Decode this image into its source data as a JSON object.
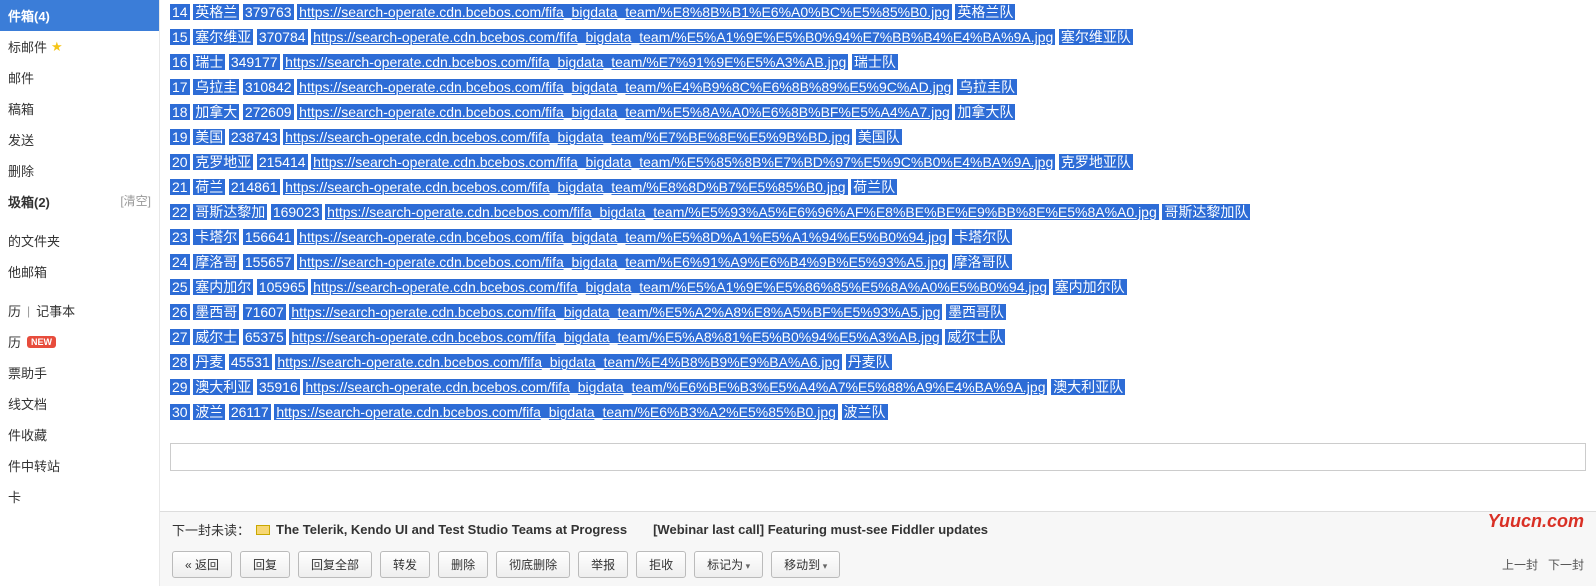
{
  "sidebar": {
    "inbox": "件箱(4)",
    "star": "标邮件",
    "mail": "邮件",
    "draft": "稿箱",
    "send": "发送",
    "delete": "删除",
    "trash": "圾箱(2)",
    "trash_clear": "[清空]",
    "folder": "的文件夹",
    "other_mail": "他邮箱",
    "cal": "历",
    "sep": "|",
    "notes": "记事本",
    "cal2": "历",
    "new_badge": "NEW",
    "bill": "票助手",
    "doc": "线文档",
    "fav": "件收藏",
    "transfer": "件中转站",
    "card": "卡"
  },
  "rows": [
    {
      "n": "14",
      "name": "英格兰",
      "num": "379763",
      "url": "https://search-operate.cdn.bcebos.com/fifa_bigdata_team/%E8%8B%B1%E6%A0%BC%E5%85%B0.jpg",
      "team": "英格兰队"
    },
    {
      "n": "15",
      "name": "塞尔维亚",
      "num": "370784",
      "url": "https://search-operate.cdn.bcebos.com/fifa_bigdata_team/%E5%A1%9E%E5%B0%94%E7%BB%B4%E4%BA%9A.jpg",
      "team": "塞尔维亚队"
    },
    {
      "n": "16",
      "name": "瑞士",
      "num": "349177",
      "url": "https://search-operate.cdn.bcebos.com/fifa_bigdata_team/%E7%91%9E%E5%A3%AB.jpg",
      "team": "瑞士队"
    },
    {
      "n": "17",
      "name": "乌拉圭",
      "num": "310842",
      "url": "https://search-operate.cdn.bcebos.com/fifa_bigdata_team/%E4%B9%8C%E6%8B%89%E5%9C%AD.jpg",
      "team": "乌拉圭队"
    },
    {
      "n": "18",
      "name": "加拿大",
      "num": "272609",
      "url": "https://search-operate.cdn.bcebos.com/fifa_bigdata_team/%E5%8A%A0%E6%8B%BF%E5%A4%A7.jpg",
      "team": "加拿大队"
    },
    {
      "n": "19",
      "name": "美国",
      "num": "238743",
      "url": "https://search-operate.cdn.bcebos.com/fifa_bigdata_team/%E7%BE%8E%E5%9B%BD.jpg",
      "team": "美国队"
    },
    {
      "n": "20",
      "name": "克罗地亚",
      "num": "215414",
      "url": "https://search-operate.cdn.bcebos.com/fifa_bigdata_team/%E5%85%8B%E7%BD%97%E5%9C%B0%E4%BA%9A.jpg",
      "team": "克罗地亚队"
    },
    {
      "n": "21",
      "name": "荷兰",
      "num": "214861",
      "url": "https://search-operate.cdn.bcebos.com/fifa_bigdata_team/%E8%8D%B7%E5%85%B0.jpg",
      "team": "荷兰队"
    },
    {
      "n": "22",
      "name": "哥斯达黎加",
      "num": "169023",
      "url": "https://search-operate.cdn.bcebos.com/fifa_bigdata_team/%E5%93%A5%E6%96%AF%E8%BE%BE%E9%BB%8E%E5%8A%A0.jpg",
      "team": "哥斯达黎加队"
    },
    {
      "n": "23",
      "name": "卡塔尔",
      "num": "156641",
      "url": "https://search-operate.cdn.bcebos.com/fifa_bigdata_team/%E5%8D%A1%E5%A1%94%E5%B0%94.jpg",
      "team": "卡塔尔队"
    },
    {
      "n": "24",
      "name": "摩洛哥",
      "num": "155657",
      "url": "https://search-operate.cdn.bcebos.com/fifa_bigdata_team/%E6%91%A9%E6%B4%9B%E5%93%A5.jpg",
      "team": "摩洛哥队"
    },
    {
      "n": "25",
      "name": "塞内加尔",
      "num": "105965",
      "url": "https://search-operate.cdn.bcebos.com/fifa_bigdata_team/%E5%A1%9E%E5%86%85%E5%8A%A0%E5%B0%94.jpg",
      "team": "塞内加尔队"
    },
    {
      "n": "26",
      "name": "墨西哥",
      "num": "71607",
      "url": "https://search-operate.cdn.bcebos.com/fifa_bigdata_team/%E5%A2%A8%E8%A5%BF%E5%93%A5.jpg",
      "team": "墨西哥队"
    },
    {
      "n": "27",
      "name": "威尔士",
      "num": "65375",
      "url": "https://search-operate.cdn.bcebos.com/fifa_bigdata_team/%E5%A8%81%E5%B0%94%E5%A3%AB.jpg",
      "team": "威尔士队"
    },
    {
      "n": "28",
      "name": "丹麦",
      "num": "45531",
      "url": "https://search-operate.cdn.bcebos.com/fifa_bigdata_team/%E4%B8%B9%E9%BA%A6.jpg",
      "team": "丹麦队"
    },
    {
      "n": "29",
      "name": "澳大利亚",
      "num": "35916",
      "url": "https://search-operate.cdn.bcebos.com/fifa_bigdata_team/%E6%BE%B3%E5%A4%A7%E5%88%A9%E4%BA%9A.jpg",
      "team": "澳大利亚队"
    },
    {
      "n": "30",
      "name": "波兰",
      "num": "26117",
      "url": "https://search-operate.cdn.bcebos.com/fifa_bigdata_team/%E6%B3%A2%E5%85%B0.jpg",
      "team": "波兰队"
    }
  ],
  "next": {
    "label": "下一封未读：",
    "title": "The Telerik, Kendo UI and Test Studio Teams at Progress",
    "sub": "[Webinar last call] Featuring must-see Fiddler updates"
  },
  "btns": {
    "back": "« 返回",
    "reply": "回复",
    "reply_all": "回复全部",
    "forward": "转发",
    "del": "删除",
    "del_perm": "彻底删除",
    "report": "举报",
    "reject": "拒收",
    "mark": "标记为",
    "move": "移动到"
  },
  "pager": {
    "prev": "上一封",
    "next": "下一封"
  },
  "watermark": "Yuucn.com"
}
